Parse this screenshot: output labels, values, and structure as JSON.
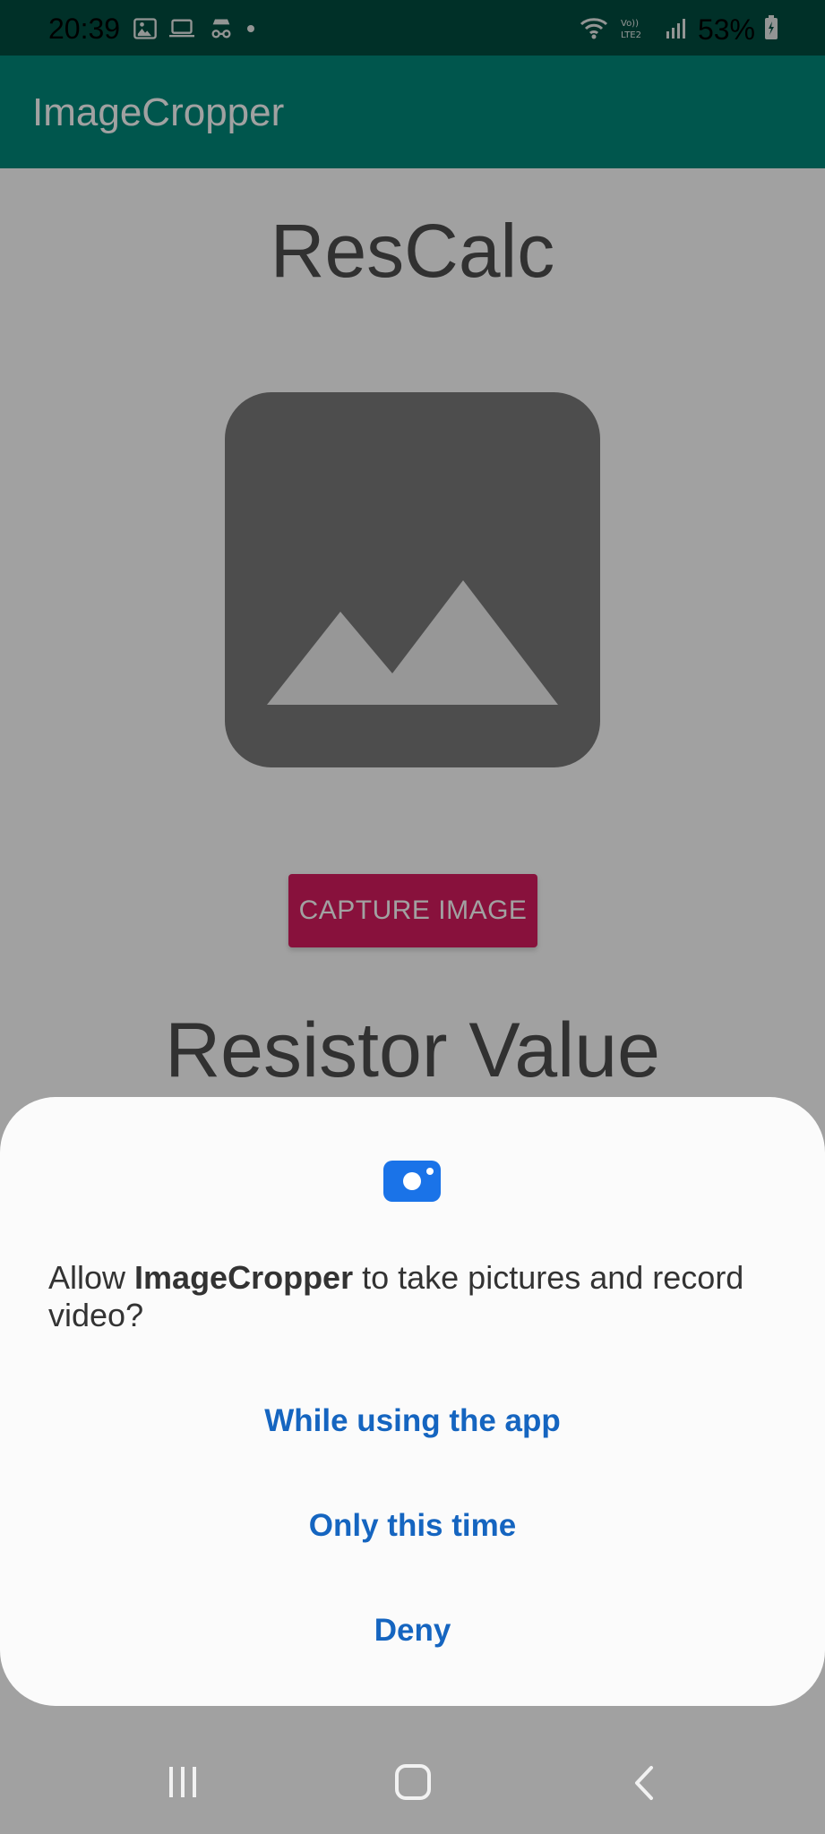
{
  "status_bar": {
    "time": "20:39",
    "left_icons": [
      "gallery-icon",
      "laptop-icon",
      "incognito-icon",
      "dot-icon"
    ],
    "right_icons": [
      "wifi-icon",
      "volte-lte2-icon",
      "signal-icon",
      "battery-charging-icon"
    ],
    "battery_percent": "53%"
  },
  "app_bar": {
    "title": "ImageCropper",
    "color": "#00897b"
  },
  "main": {
    "title": "ResCalc",
    "image_icon": "image-placeholder-icon",
    "capture_button_label": "CAPTURE IMAGE",
    "result_label": "Resistor Value",
    "accent_color": "#d81b60"
  },
  "permission_dialog": {
    "icon": "camera-icon",
    "text_before": "Allow ",
    "app_name": "ImageCropper",
    "text_after": " to take pictures and record video?",
    "buttons": {
      "while_using": "While using the app",
      "only_this_time": "Only this time",
      "deny": "Deny"
    },
    "button_color": "#1565c0"
  },
  "nav_bar": {
    "icons": [
      "recent-apps-icon",
      "home-icon",
      "back-icon"
    ]
  }
}
